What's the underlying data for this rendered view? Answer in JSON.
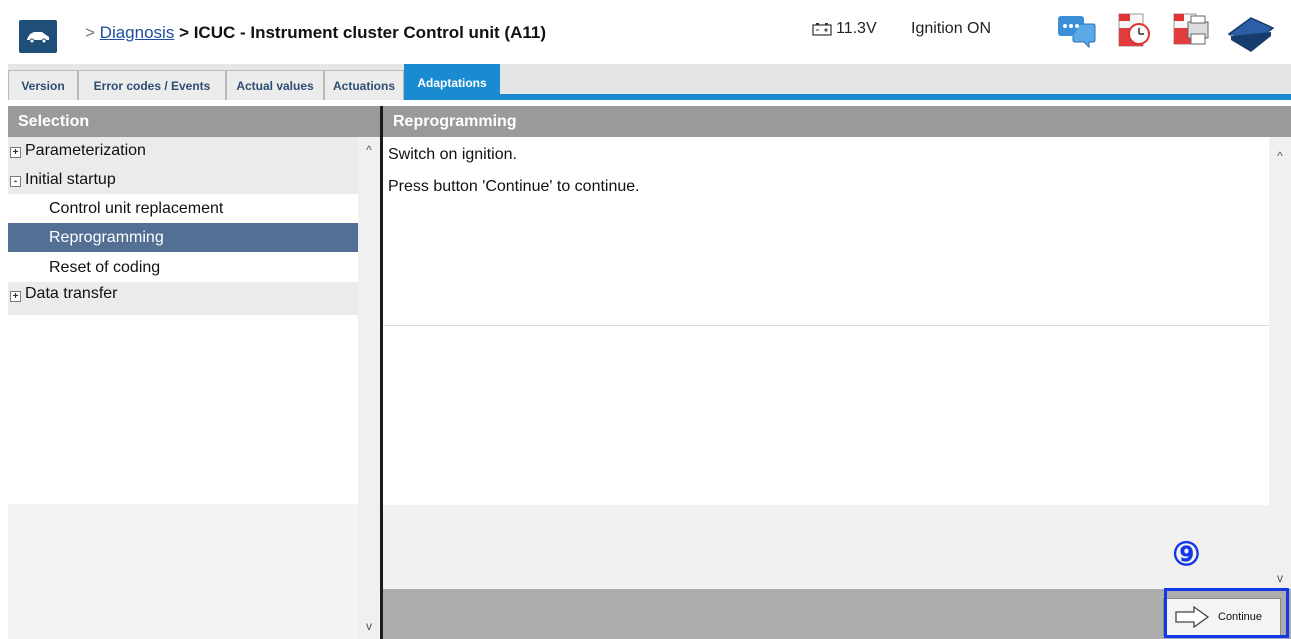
{
  "header": {
    "breadcrumb_sep": ">",
    "breadcrumb_link": "Diagnosis",
    "breadcrumb_current": "> ICUC - Instrument cluster Control unit (A11)",
    "voltage": "11.3V",
    "ignition_status": "Ignition ON",
    "icons": [
      "car-home-icon",
      "battery-icon",
      "chat-icon",
      "pdf-clock-icon",
      "pdf-print-icon",
      "manual-book-icon"
    ]
  },
  "tabs": [
    {
      "label": "Version",
      "active": false
    },
    {
      "label": "Error codes / Events",
      "active": false
    },
    {
      "label": "Actual values",
      "active": false
    },
    {
      "label": "Actuations",
      "active": false
    },
    {
      "label": "Adaptations",
      "active": true
    }
  ],
  "left_panel": {
    "title": "Selection",
    "tree": [
      {
        "label": "Parameterization",
        "type": "group",
        "toggle": "+"
      },
      {
        "label": "Initial startup",
        "type": "group",
        "toggle": "-"
      },
      {
        "label": "Control unit replacement",
        "type": "child"
      },
      {
        "label": "Reprogramming",
        "type": "child",
        "selected": true
      },
      {
        "label": "Reset of coding",
        "type": "child"
      },
      {
        "label": "Data transfer",
        "type": "group",
        "toggle": "+"
      }
    ]
  },
  "right_panel": {
    "title": "Reprogramming",
    "lines": [
      "Switch on ignition.",
      "Press button 'Continue' to continue."
    ],
    "continue_label": "Continue"
  },
  "annotation": {
    "step_marker": "⑨"
  },
  "colors": {
    "accent_blue": "#1a8bd0",
    "selected_row": "#536f94",
    "panel_header": "#9a9a9a",
    "highlight": "#1237e6"
  }
}
